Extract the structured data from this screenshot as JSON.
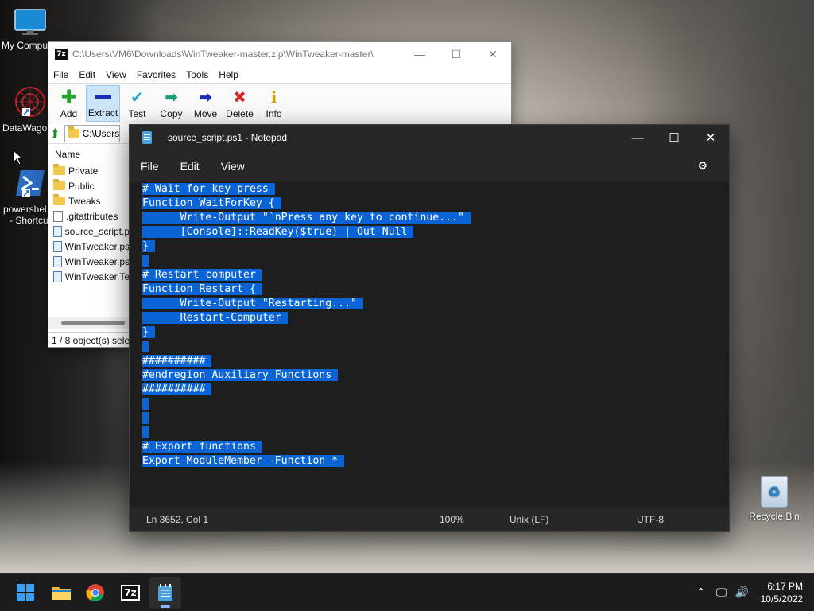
{
  "desktop": {
    "icons": [
      {
        "label": "My Compu"
      },
      {
        "label": "DataWago"
      },
      {
        "label": "powershel"
      },
      {
        "label": "- Shortcu"
      }
    ],
    "recycle_bin": {
      "label": "Recycle Bin"
    }
  },
  "zip_window": {
    "title": "C:\\Users\\VM6\\Downloads\\WinTweaker-master.zip\\WinTweaker-master\\",
    "menu": [
      "File",
      "Edit",
      "View",
      "Favorites",
      "Tools",
      "Help"
    ],
    "toolbar": [
      {
        "label": "Add",
        "icon": "plus-icon",
        "color": "#22a52a"
      },
      {
        "label": "Extract",
        "icon": "minus-icon",
        "color": "#1a2fb5"
      },
      {
        "label": "Test",
        "icon": "check-icon",
        "color": "#2aa8c8"
      },
      {
        "label": "Copy",
        "icon": "arrow-right-icon",
        "color": "#1c9a7a"
      },
      {
        "label": "Move",
        "icon": "arrow-right-icon",
        "color": "#1a2fb5"
      },
      {
        "label": "Delete",
        "icon": "x-icon",
        "color": "#d22a2a"
      },
      {
        "label": "Info",
        "icon": "info-icon",
        "color": "#c9a400"
      }
    ],
    "address": "C:\\Users",
    "column_header": "Name",
    "files": [
      {
        "name": "Private",
        "type": "folder"
      },
      {
        "name": "Public",
        "type": "folder"
      },
      {
        "name": "Tweaks",
        "type": "folder"
      },
      {
        "name": ".gitattributes",
        "type": "file"
      },
      {
        "name": "source_script.p",
        "type": "ps"
      },
      {
        "name": "WinTweaker.ps",
        "type": "ps"
      },
      {
        "name": "WinTweaker.ps",
        "type": "ps"
      },
      {
        "name": "WinTweaker.Te",
        "type": "ps"
      }
    ],
    "status": "1 / 8 object(s) selec"
  },
  "notepad": {
    "title": "source_script.ps1 - Notepad",
    "menu": {
      "file": "File",
      "edit": "Edit",
      "view": "View"
    },
    "code_lines": [
      "# Wait for key press ",
      "Function WaitForKey { ",
      "      Write-Output \"`nPress any key to continue...\" ",
      "      [Console]::ReadKey($true) | Out-Null ",
      "} ",
      " ",
      "# Restart computer ",
      "Function Restart { ",
      "      Write-Output \"Restarting...\" ",
      "      Restart-Computer ",
      "} ",
      " ",
      "########## ",
      "#endregion Auxiliary Functions ",
      "########## ",
      " ",
      " ",
      " ",
      "# Export functions ",
      "Export-ModuleMember -Function * "
    ],
    "status": {
      "position": "Ln 3652, Col 1",
      "zoom": "100%",
      "line_ending": "Unix (LF)",
      "encoding": "UTF-8"
    },
    "selection_color": "#0a64d6"
  },
  "taskbar": {
    "clock_time": "6:17 PM",
    "clock_date": "10/5/2022",
    "zip_label": "7z"
  }
}
